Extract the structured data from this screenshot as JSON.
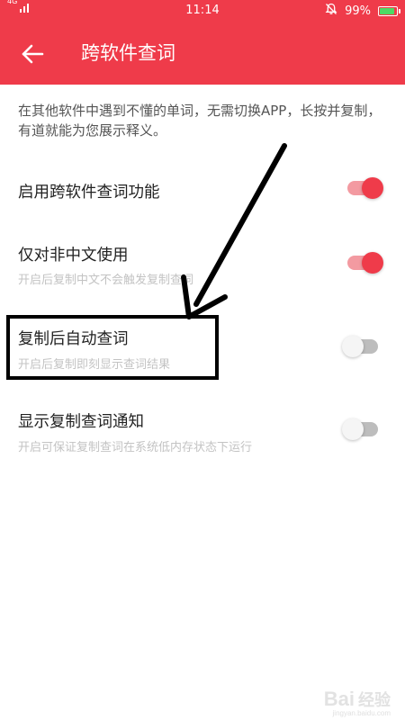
{
  "status_bar": {
    "network": "4G",
    "time": "11:14",
    "battery": "99%",
    "battery_level": 0.99,
    "bell_icon": "bell-off-icon",
    "battery_icon": "battery-charging-icon"
  },
  "header": {
    "back_icon": "arrow-left-icon",
    "title": "跨软件查词"
  },
  "description": "在其他软件中遇到不懂的单词，无需切换APP，长按并复制，有道就能为您展示释义。",
  "settings": [
    {
      "title": "启用跨软件查词功能",
      "subtitle": "",
      "enabled": true
    },
    {
      "title": "仅对非中文使用",
      "subtitle": "开启后复制中文不会触发复制查词",
      "enabled": true
    },
    {
      "title": "复制后自动查词",
      "subtitle": "开启后复制即刻显示查词结果",
      "enabled": false
    },
    {
      "title": "显示复制查词通知",
      "subtitle": "开启可保证复制查词在系统低内存状态下运行",
      "enabled": false
    }
  ],
  "watermark": {
    "logo": "Bai",
    "logo_cn": "经验",
    "url": "jingyan.baidu.com"
  },
  "colors": {
    "accent": "#ef3b4a",
    "switch_on_track": "#f39aa1",
    "switch_off_track": "#bdbdbd",
    "subtitle": "#c3c3c3"
  }
}
